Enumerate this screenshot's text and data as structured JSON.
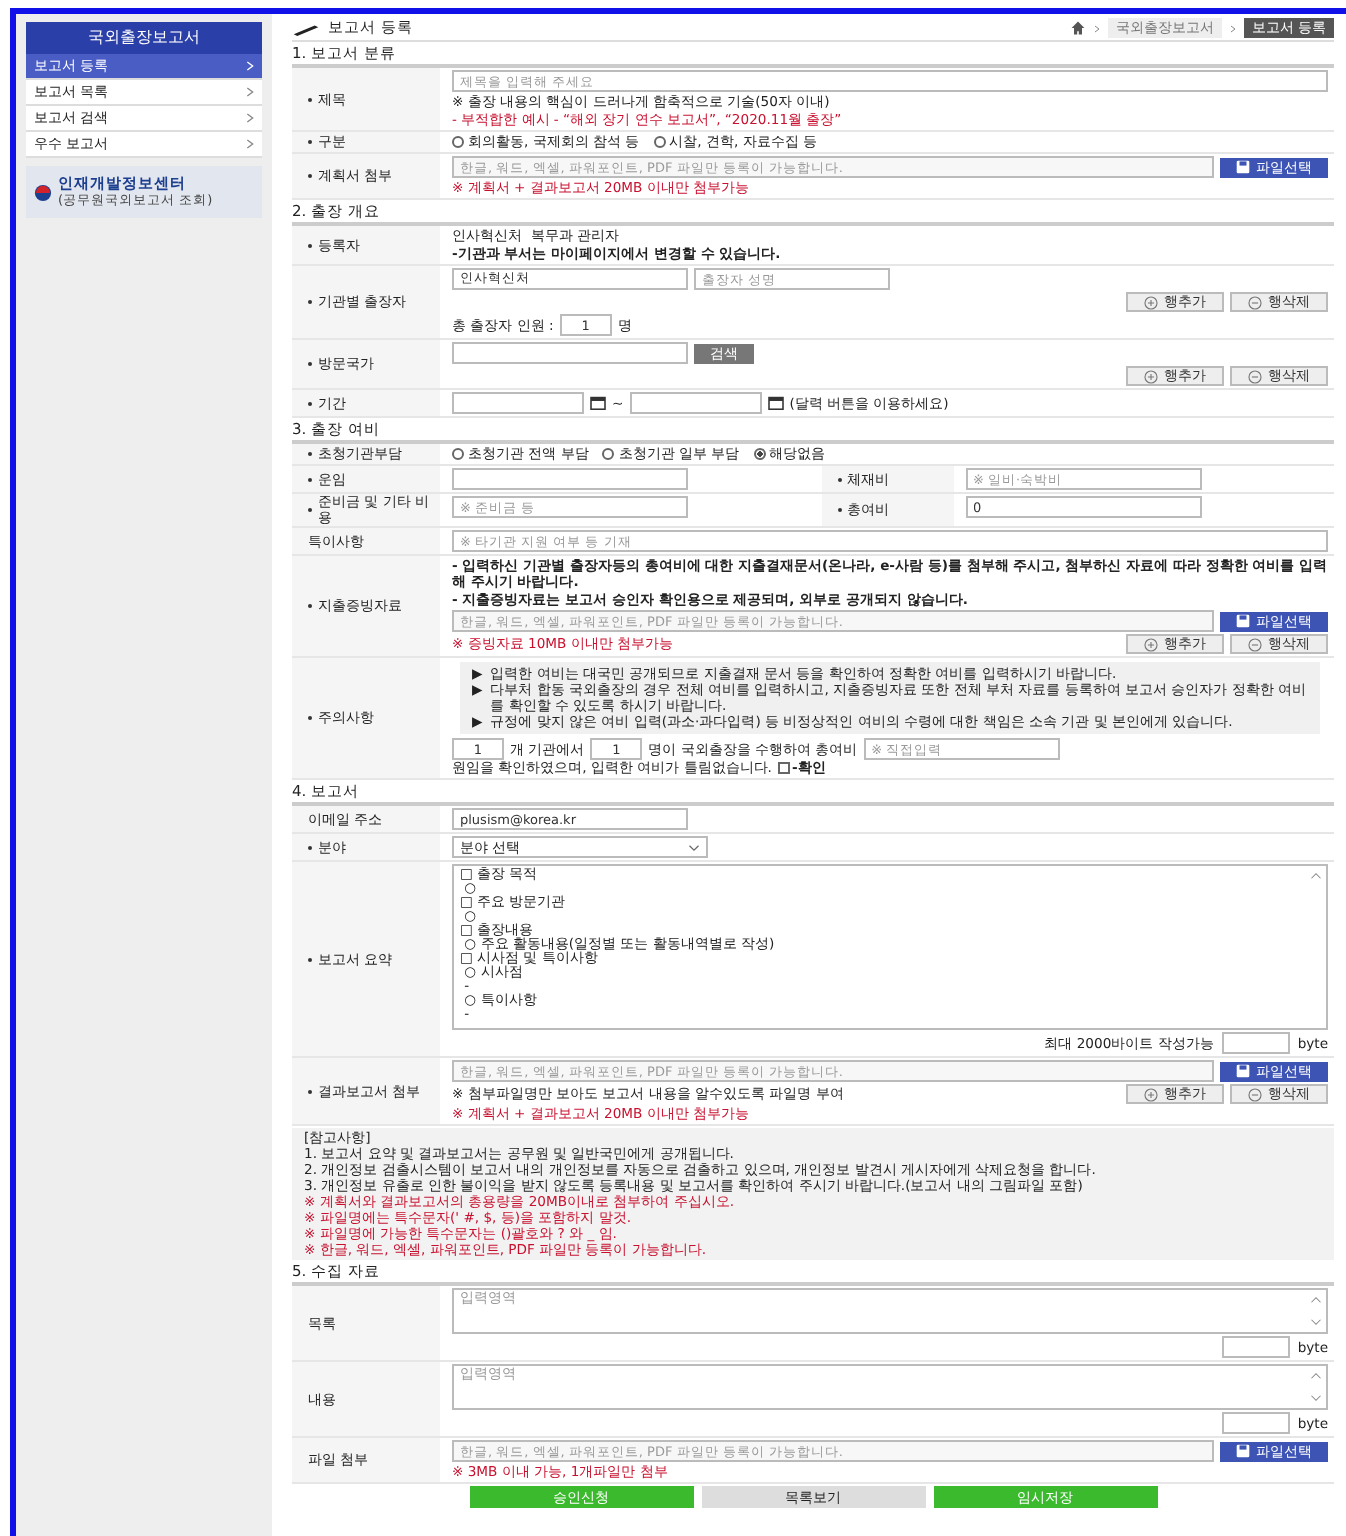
{
  "sidebar": {
    "title": "국외출장보고서",
    "items": [
      {
        "label": "보고서 등록",
        "selected": true
      },
      {
        "label": "보고서 목록",
        "selected": false
      },
      {
        "label": "보고서 검색",
        "selected": false
      },
      {
        "label": "우수 보고서",
        "selected": false
      }
    ],
    "banner": {
      "title": "인재개발정보센터",
      "subtitle": "(공무원국외보고서 조회)"
    }
  },
  "header": {
    "title": "보고서 등록",
    "breadcrumb": [
      "국외출장보고서",
      "보고서 등록"
    ]
  },
  "sections": [
    {
      "title": "1. 보고서 분류",
      "rows": [
        {
          "cells": [
            {
              "label": "제목",
              "required": true,
              "lines": [
                [
                  {
                    "kind": "field",
                    "placeholder": "제목을 입력해 주세요"
                  }
                ],
                [
                  {
                    "kind": "note",
                    "text": "※ 출장 내용의 핵심이 드러나게 함축적으로 기술(50자 이내)"
                  }
                ],
                [
                  {
                    "kind": "warning",
                    "text": "- 부적합한 예시 - “해외 장기 연수 보고서”, “2020.11월 출장”"
                  }
                ]
              ]
            }
          ]
        },
        {
          "cells": [
            {
              "label": "구분",
              "required": true,
              "lines": [
                [
                  {
                    "kind": "radios",
                    "options": [
                      {
                        "label": "회의활동, 국제회의 참석 등",
                        "selected": false
                      },
                      {
                        "label": "시찰, 견학, 자료수집 등",
                        "selected": false
                      }
                    ]
                  }
                ]
              ]
            }
          ]
        },
        {
          "cells": [
            {
              "label": "계획서 첨부",
              "required": true,
              "lines": [
                [
                  {
                    "kind": "file",
                    "placeholder": "한글, 워드, 엑셀, 파워포인트, PDF 파일만 등록이 가능합니다.",
                    "button": "파일선택"
                  }
                ],
                [
                  {
                    "kind": "warning",
                    "text": "※ 계획서 + 결과보고서 20MB 이내만 첨부가능"
                  }
                ]
              ]
            }
          ]
        }
      ]
    },
    {
      "title": "2. 출장 개요",
      "rows": [
        {
          "cells": [
            {
              "label": "등록자",
              "required": true,
              "lines": [
                [
                  {
                    "kind": "note",
                    "text": "인사혁신처  복무과 관리자"
                  }
                ],
                [
                  {
                    "kind": "bold",
                    "text": "-기관과 부서는 마이페이지에서 변경할 수 있습니다."
                  }
                ]
              ]
            }
          ]
        },
        {
          "cells": [
            {
              "label": "기관별 출장자",
              "required": true,
              "lines": [
                [
                  {
                    "kind": "shortfield",
                    "value": "인사혁신처"
                  },
                  {
                    "kind": "smallfield",
                    "placeholder": "출장자 성명"
                  }
                ],
                [
                  {
                    "kind": "rowbuttons",
                    "buttons": [
                      "행추가",
                      "행삭제"
                    ]
                  }
                ],
                [
                  {
                    "kind": "note",
                    "text": "총 출장자 인원 :"
                  },
                  {
                    "kind": "numfield",
                    "value": "1"
                  },
                  {
                    "kind": "note",
                    "text": "명"
                  }
                ]
              ]
            }
          ]
        },
        {
          "cells": [
            {
              "label": "방문국가",
              "required": true,
              "lines": [
                [
                  {
                    "kind": "shortfield"
                  },
                  {
                    "kind": "search",
                    "label": "검색"
                  }
                ],
                [
                  {
                    "kind": "rowbuttons",
                    "buttons": [
                      "행추가",
                      "행삭제"
                    ]
                  }
                ]
              ]
            }
          ]
        },
        {
          "cells": [
            {
              "label": "기간",
              "required": true,
              "lines": [
                [
                  {
                    "kind": "date"
                  },
                  {
                    "kind": "note",
                    "text": "~"
                  },
                  {
                    "kind": "date"
                  },
                  {
                    "kind": "note",
                    "text": "(달력 버튼을 이용하세요)"
                  }
                ]
              ]
            }
          ]
        }
      ]
    },
    {
      "title": "3. 출장 여비",
      "rows": [
        {
          "cells": [
            {
              "label": "초청기관부담",
              "required": true,
              "lines": [
                [
                  {
                    "kind": "radios",
                    "options": [
                      {
                        "label": "초청기관 전액 부담",
                        "selected": false
                      },
                      {
                        "label": "초청기관 일부 부담",
                        "selected": false
                      },
                      {
                        "label": "해당없음",
                        "selected": true
                      }
                    ]
                  }
                ]
              ]
            }
          ]
        },
        {
          "cells": [
            {
              "label": "운임",
              "required": true,
              "lines": [
                [
                  {
                    "kind": "shortfield"
                  }
                ]
              ]
            },
            {
              "label": "체재비",
              "required": true,
              "lines": [
                [
                  {
                    "kind": "shortfield",
                    "placeholder": "※ 일비·숙박비"
                  }
                ]
              ]
            }
          ]
        },
        {
          "cells": [
            {
              "label": "준비금 및 기타 비용",
              "required": true,
              "lines": [
                [
                  {
                    "kind": "shortfield",
                    "placeholder": "※ 준비금 등"
                  }
                ]
              ]
            },
            {
              "label": "총여비",
              "required": true,
              "lines": [
                [
                  {
                    "kind": "shortfield",
                    "value": "0"
                  }
                ]
              ]
            }
          ]
        },
        {
          "cells": [
            {
              "label": "특이사항",
              "required": false,
              "lines": [
                [
                  {
                    "kind": "field",
                    "placeholder": "※ 타기관 지원 여부 등 기재"
                  }
                ]
              ]
            }
          ]
        },
        {
          "cells": [
            {
              "label": "지출증빙자료",
              "required": true,
              "lines": [
                [
                  {
                    "kind": "bold",
                    "text": "- 입력하신 기관별 출장자등의 총여비에 대한 지출결재문서(온나라, e-사람 등)를 첨부해 주시고, 첨부하신 자료에 따라 정확한 여비를 입력해 주시기 바랍니다."
                  }
                ],
                [
                  {
                    "kind": "bold",
                    "text": "- 지출증빙자료는 보고서 승인자 확인용으로 제공되며, 외부로 공개되지 않습니다."
                  }
                ],
                [
                  {
                    "kind": "file",
                    "placeholder": "한글, 워드, 엑셀, 파워포인트, PDF 파일만 등록이 가능합니다.",
                    "button": "파일선택"
                  }
                ],
                [
                  {
                    "kind": "warning",
                    "text": "※ 증빙자료 10MB 이내만 첨부가능"
                  },
                  {
                    "kind": "rowbuttons",
                    "buttons": [
                      "행추가",
                      "행삭제"
                    ]
                  }
                ]
              ]
            }
          ]
        },
        {
          "cells": [
            {
              "label": "주의사항",
              "required": true,
              "lines": [
                [
                  {
                    "kind": "notice",
                    "items": [
                      {
                        "marker": "▶",
                        "text": "입력한 여비는 대국민 공개되므로 지출결재 문서 등을 확인하여 정확한 여비를 입력하시기 바랍니다."
                      },
                      {
                        "marker": "▶",
                        "text": "다부처 합동 국외출장의 경우 전체 여비를 입력하시고, 지출증빙자료 또한 전체 부처 자료를 등록하여 보고서 승인자가 정확한 여비를 확인할 수 있도록 하시기 바랍니다."
                      },
                      {
                        "marker": "▶",
                        "text": "규정에 맞지 않은 여비 입력(과소·과다입력) 등 비정상적인 여비의 수령에 대한 책임은 소속 기관 및 본인에게 있습니다."
                      }
                    ]
                  }
                ],
                [
                  {
                    "kind": "numfield",
                    "value": "1"
                  },
                  {
                    "kind": "note",
                    "text": "개 기관에서"
                  },
                  {
                    "kind": "numfield",
                    "value": "1"
                  },
                  {
                    "kind": "note",
                    "text": "명이 국외출장을 수행하여 총여비"
                  },
                  {
                    "kind": "smallfield",
                    "placeholder": "※ 직접입력"
                  },
                  {
                    "kind": "note",
                    "text": "원임을 확인하였으며, 입력한 여비가 틀림없습니다."
                  },
                  {
                    "kind": "checkbox",
                    "label": "-확인",
                    "checked": false
                  }
                ]
              ]
            }
          ]
        }
      ]
    },
    {
      "title": "4. 보고서",
      "rows": [
        {
          "cells": [
            {
              "label": "이메일 주소",
              "required": false,
              "lines": [
                [
                  {
                    "kind": "shortfield",
                    "value": "plusism@korea.kr"
                  }
                ]
              ]
            }
          ]
        },
        {
          "cells": [
            {
              "label": "분야",
              "required": true,
              "lines": [
                [
                  {
                    "kind": "select",
                    "value": "분야 선택"
                  }
                ]
              ]
            }
          ]
        },
        {
          "cells": [
            {
              "label": "보고서 요약",
              "required": true,
              "lines": [
                [
                  {
                    "kind": "editor",
                    "lines": [
                      "□ 출장 목적",
                      " ○",
                      "□ 주요 방문기관",
                      " ○",
                      "□ 출장내용",
                      " ○ 주요 활동내용(일정별 또는 활동내역별로 작성)",
                      "□ 시사점 및 특이사항",
                      " ○ 시사점",
                      " -",
                      " ○ 특이사항",
                      " -"
                    ]
                  }
                ],
                [
                  {
                    "kind": "counter",
                    "text": "최대 2000바이트 작성가능",
                    "unit": "byte"
                  }
                ]
              ]
            }
          ]
        },
        {
          "cells": [
            {
              "label": "결과보고서 첨부",
              "required": true,
              "lines": [
                [
                  {
                    "kind": "file",
                    "placeholder": "한글, 워드, 엑셀, 파워포인트, PDF 파일만 등록이 가능합니다.",
                    "button": "파일선택"
                  }
                ],
                [
                  {
                    "kind": "note",
                    "text": "※ 첨부파일명만 보아도 보고서 내용을 알수있도록 파일명 부여"
                  },
                  {
                    "kind": "rowbuttons",
                    "buttons": [
                      "행추가",
                      "행삭제"
                    ]
                  }
                ],
                [
                  {
                    "kind": "warning",
                    "text": "※ 계획서 + 결과보고서 20MB 이내만 첨부가능"
                  }
                ]
              ]
            }
          ]
        }
      ],
      "notes": {
        "heading": "[참고사항]",
        "items": [
          {
            "text": "1. 보고서 요약 및 결과보고서는 공무원 및 일반국민에게 공개됩니다.",
            "warning": false
          },
          {
            "text": "2. 개인정보 검출시스템이 보고서 내의 개인정보를 자동으로 검출하고 있으며, 개인정보 발견시 게시자에게 삭제요청을 합니다.",
            "warning": false
          },
          {
            "text": "3. 개인정보 유출로 인한 불이익을 받지 않도록 등록내용 및 보고서를 확인하여 주시기 바랍니다.(보고서 내의 그림파일 포함)",
            "warning": false
          },
          {
            "text": "※ 계획서와 결과보고서의 총용량을 20MB이내로 첨부하여 주십시오.",
            "warning": true
          },
          {
            "text": "※ 파일명에는 특수문자(' #, $, 등)을 포함하지 말것.",
            "warning": true
          },
          {
            "text": "※ 파일명에 가능한 특수문자는 ()괄호와 ? 와 _ 임.",
            "warning": true
          },
          {
            "text": "※ 한글, 워드, 엑셀, 파워포인트, PDF 파일만 등록이 가능합니다.",
            "warning": true
          }
        ]
      }
    },
    {
      "title": "5. 수집 자료",
      "rows": [
        {
          "cells": [
            {
              "label": "목록",
              "required": false,
              "lines": [
                [
                  {
                    "kind": "textarea",
                    "placeholder": "입력영역"
                  }
                ],
                [
                  {
                    "kind": "counter",
                    "unit": "byte"
                  }
                ]
              ]
            }
          ]
        },
        {
          "cells": [
            {
              "label": "내용",
              "required": false,
              "lines": [
                [
                  {
                    "kind": "textarea",
                    "placeholder": "입력영역"
                  }
                ],
                [
                  {
                    "kind": "counter",
                    "unit": "byte"
                  }
                ]
              ]
            }
          ]
        },
        {
          "cells": [
            {
              "label": "파일 첨부",
              "required": false,
              "lines": [
                [
                  {
                    "kind": "file",
                    "placeholder": "한글, 워드, 엑셀, 파워포인트, PDF 파일만 등록이 가능합니다.",
                    "button": "파일선택"
                  }
                ],
                [
                  {
                    "kind": "warning",
                    "text": "※ 3MB 이내 가능, 1개파일만 첨부"
                  }
                ]
              ]
            }
          ]
        }
      ]
    }
  ],
  "actions": [
    {
      "label": "승인신청",
      "kind": "primary"
    },
    {
      "label": "목록보기",
      "kind": "secondary"
    },
    {
      "label": "임시저장",
      "kind": "primary"
    }
  ]
}
